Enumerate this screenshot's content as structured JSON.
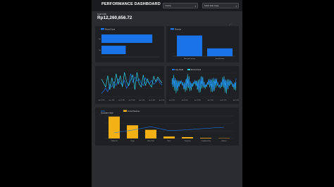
{
  "header": {
    "title": "PERFORMANCE DASHBOARD",
    "filters": [
      {
        "value": "Country"
      },
      {
        "value": "Select date range"
      }
    ]
  },
  "kpi": {
    "label": "Total GDR",
    "value": "Rp12,260,656.72"
  },
  "colors": {
    "blue": "#1a73e8",
    "cyan": "#2ed1e6",
    "orange": "#f3b116",
    "panel": "#1f2023",
    "background": "#2b2c30"
  },
  "panel_icons": "⤢ ⋮",
  "charts": {
    "hbar": {
      "type": "bar",
      "orientation": "horizontal",
      "legend": "Record Count",
      "categories": [
        "Yes",
        "No"
      ],
      "values": [
        88,
        42
      ],
      "xlim": [
        0,
        100
      ]
    },
    "vbar": {
      "type": "bar",
      "legend": "Revenue",
      "categories": [
        "Returned Invoices",
        "Good Invoices"
      ],
      "values": [
        0.82,
        0.31
      ]
    },
    "line1": {
      "type": "line",
      "series": [
        {
          "color": "#1a73e8",
          "values": [
            30,
            34,
            38,
            33,
            44,
            40,
            48,
            42,
            52,
            46,
            43,
            50,
            38,
            44,
            60,
            47,
            55,
            49,
            52,
            46,
            42,
            54,
            48,
            45,
            50,
            44,
            47,
            52,
            46,
            43
          ]
        },
        {
          "color": "#2ed1e6",
          "values": [
            52,
            46,
            40,
            57,
            36,
            54,
            38,
            60,
            44,
            57,
            40,
            62,
            48,
            42,
            50,
            58,
            36,
            62,
            45,
            40,
            58,
            42,
            52,
            44,
            40,
            56,
            48,
            55,
            50,
            46
          ]
        }
      ],
      "x_ticks": [
        "Jan 14, 2011",
        "Jan 1, 2011",
        "Jan 15, 2011",
        "Jan 27, 2011",
        "Jan 7, 2011",
        "Jan 21, 2011",
        "Jan 10, 2011"
      ]
    },
    "line2": {
      "type": "line",
      "series": [
        {
          "name": "Avg. Retail",
          "color": "#1a73e8"
        },
        {
          "name": "Record Count",
          "color": "#2ed1e6"
        }
      ],
      "x_ticks": [
        "Jan 1, 2011",
        "Jan 15, 2011",
        "Jan 27, 2011",
        "Jan 7, 2011",
        "Jan 21, 2011",
        "Jan 10, 2011"
      ]
    },
    "combo": {
      "type": "bar",
      "series": [
        {
          "name": "Cumulative Value",
          "type": "line",
          "color": "#1a73e8"
        },
        {
          "name": "Current Revenue",
          "type": "bar",
          "color": "#f3b116"
        }
      ],
      "categories": [
        "Golden Fit",
        "Drape",
        "Office Sole",
        "Neon",
        "Corporate",
        "Complimentary",
        "Autumn"
      ],
      "values": [
        78,
        47,
        31,
        7,
        5,
        2,
        1
      ],
      "cumulative": [
        20,
        30,
        42,
        28,
        31,
        36,
        40
      ]
    }
  }
}
